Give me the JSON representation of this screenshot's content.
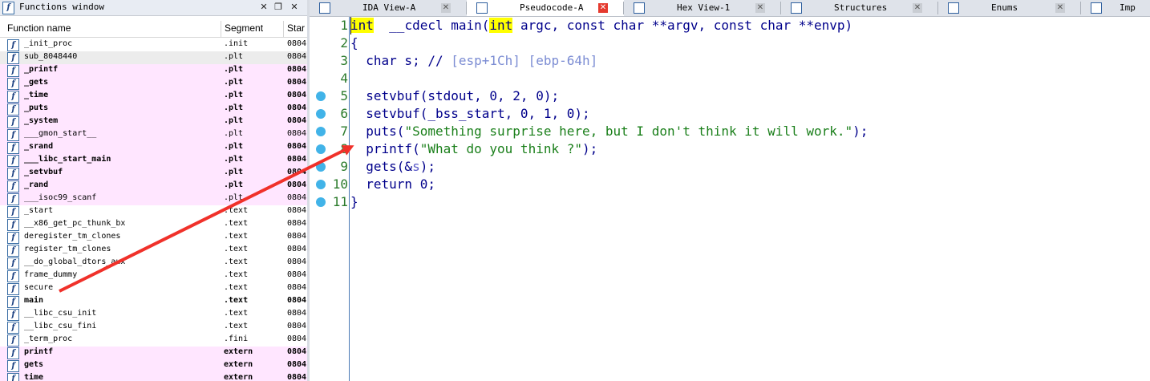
{
  "functions_window": {
    "title": "Functions window",
    "columns": [
      "Function name",
      "Segment",
      "Star"
    ],
    "rows": [
      {
        "name": "_init_proc",
        "segment": ".init",
        "start": "0804",
        "style": "normal"
      },
      {
        "name": "sub_8048440",
        "segment": ".plt",
        "start": "0804",
        "style": "selected"
      },
      {
        "name": "_printf",
        "segment": ".plt",
        "start": "0804",
        "style": "bold-hl"
      },
      {
        "name": "_gets",
        "segment": ".plt",
        "start": "0804",
        "style": "bold-hl"
      },
      {
        "name": "_time",
        "segment": ".plt",
        "start": "0804",
        "style": "bold-hl"
      },
      {
        "name": "_puts",
        "segment": ".plt",
        "start": "0804",
        "style": "bold-hl"
      },
      {
        "name": "_system",
        "segment": ".plt",
        "start": "0804",
        "style": "bold-hl"
      },
      {
        "name": "___gmon_start__",
        "segment": ".plt",
        "start": "0804",
        "style": "hl"
      },
      {
        "name": "_srand",
        "segment": ".plt",
        "start": "0804",
        "style": "bold-hl"
      },
      {
        "name": "___libc_start_main",
        "segment": ".plt",
        "start": "0804",
        "style": "bold-hl"
      },
      {
        "name": "_setvbuf",
        "segment": ".plt",
        "start": "0804",
        "style": "bold-hl"
      },
      {
        "name": "_rand",
        "segment": ".plt",
        "start": "0804",
        "style": "bold-hl"
      },
      {
        "name": "___isoc99_scanf",
        "segment": ".plt",
        "start": "0804",
        "style": "hl"
      },
      {
        "name": "_start",
        "segment": ".text",
        "start": "0804",
        "style": "normal"
      },
      {
        "name": "__x86_get_pc_thunk_bx",
        "segment": ".text",
        "start": "0804",
        "style": "normal"
      },
      {
        "name": "deregister_tm_clones",
        "segment": ".text",
        "start": "0804",
        "style": "normal"
      },
      {
        "name": "register_tm_clones",
        "segment": ".text",
        "start": "0804",
        "style": "normal"
      },
      {
        "name": "__do_global_dtors_aux",
        "segment": ".text",
        "start": "0804",
        "style": "normal"
      },
      {
        "name": "frame_dummy",
        "segment": ".text",
        "start": "0804",
        "style": "normal"
      },
      {
        "name": "secure",
        "segment": ".text",
        "start": "0804",
        "style": "normal"
      },
      {
        "name": "main",
        "segment": ".text",
        "start": "0804",
        "style": "bold"
      },
      {
        "name": "__libc_csu_init",
        "segment": ".text",
        "start": "0804",
        "style": "normal"
      },
      {
        "name": "__libc_csu_fini",
        "segment": ".text",
        "start": "0804",
        "style": "normal"
      },
      {
        "name": "_term_proc",
        "segment": ".fini",
        "start": "0804",
        "style": "normal"
      },
      {
        "name": "printf",
        "segment": "extern",
        "start": "0804",
        "style": "bold-hl"
      },
      {
        "name": "gets",
        "segment": "extern",
        "start": "0804",
        "style": "bold-hl"
      },
      {
        "name": "time",
        "segment": "extern",
        "start": "0804",
        "style": "bold-hl"
      }
    ]
  },
  "tabs": [
    {
      "label": "IDA View-A",
      "icon": "disassembly-icon",
      "active": false
    },
    {
      "label": "Pseudocode-A",
      "icon": "pseudocode-icon",
      "active": true
    },
    {
      "label": "Hex View-1",
      "icon": "hex-view-icon",
      "active": false
    },
    {
      "label": "Structures",
      "icon": "structures-icon",
      "active": false
    },
    {
      "label": "Enums",
      "icon": "enums-icon",
      "active": false
    },
    {
      "label": "Imp",
      "icon": "imports-icon",
      "active": false
    }
  ],
  "pseudocode": {
    "lines": [
      {
        "n": "1",
        "dot": false,
        "tokens": [
          [
            "kw",
            "int"
          ],
          [
            "",
            "  __cdecl main("
          ],
          [
            "kw",
            "int"
          ],
          [
            "",
            " argc, const char **argv, const char **envp)"
          ]
        ]
      },
      {
        "n": "2",
        "dot": false,
        "tokens": [
          [
            "",
            "{"
          ]
        ]
      },
      {
        "n": "3",
        "dot": false,
        "tokens": [
          [
            "",
            "  char s; // "
          ],
          [
            "cmt",
            "[esp+1Ch] [ebp-64h]"
          ]
        ]
      },
      {
        "n": "4",
        "dot": false,
        "tokens": [
          [
            "",
            ""
          ]
        ]
      },
      {
        "n": "5",
        "dot": true,
        "tokens": [
          [
            "",
            "  setvbuf(stdout, 0, 2, 0);"
          ]
        ]
      },
      {
        "n": "6",
        "dot": true,
        "tokens": [
          [
            "",
            "  setvbuf(_bss_start, 0, 1, 0);"
          ]
        ]
      },
      {
        "n": "7",
        "dot": true,
        "tokens": [
          [
            "",
            "  puts("
          ],
          [
            "str",
            "\"Something surprise here, but I don't think it will work.\""
          ],
          [
            "",
            ");"
          ]
        ]
      },
      {
        "n": "8",
        "dot": true,
        "tokens": [
          [
            "",
            "  printf("
          ],
          [
            "str",
            "\"What do you think ?\""
          ],
          [
            "",
            ");"
          ]
        ]
      },
      {
        "n": "9",
        "dot": true,
        "tokens": [
          [
            "",
            "  gets(&"
          ],
          [
            "var2",
            "s"
          ],
          [
            "",
            ");"
          ]
        ]
      },
      {
        "n": "10",
        "dot": true,
        "tokens": [
          [
            "",
            "  return 0;"
          ]
        ]
      },
      {
        "n": "11",
        "dot": true,
        "tokens": [
          [
            "",
            "}"
          ]
        ]
      }
    ]
  },
  "annotation": {
    "color": "#f0312a"
  }
}
